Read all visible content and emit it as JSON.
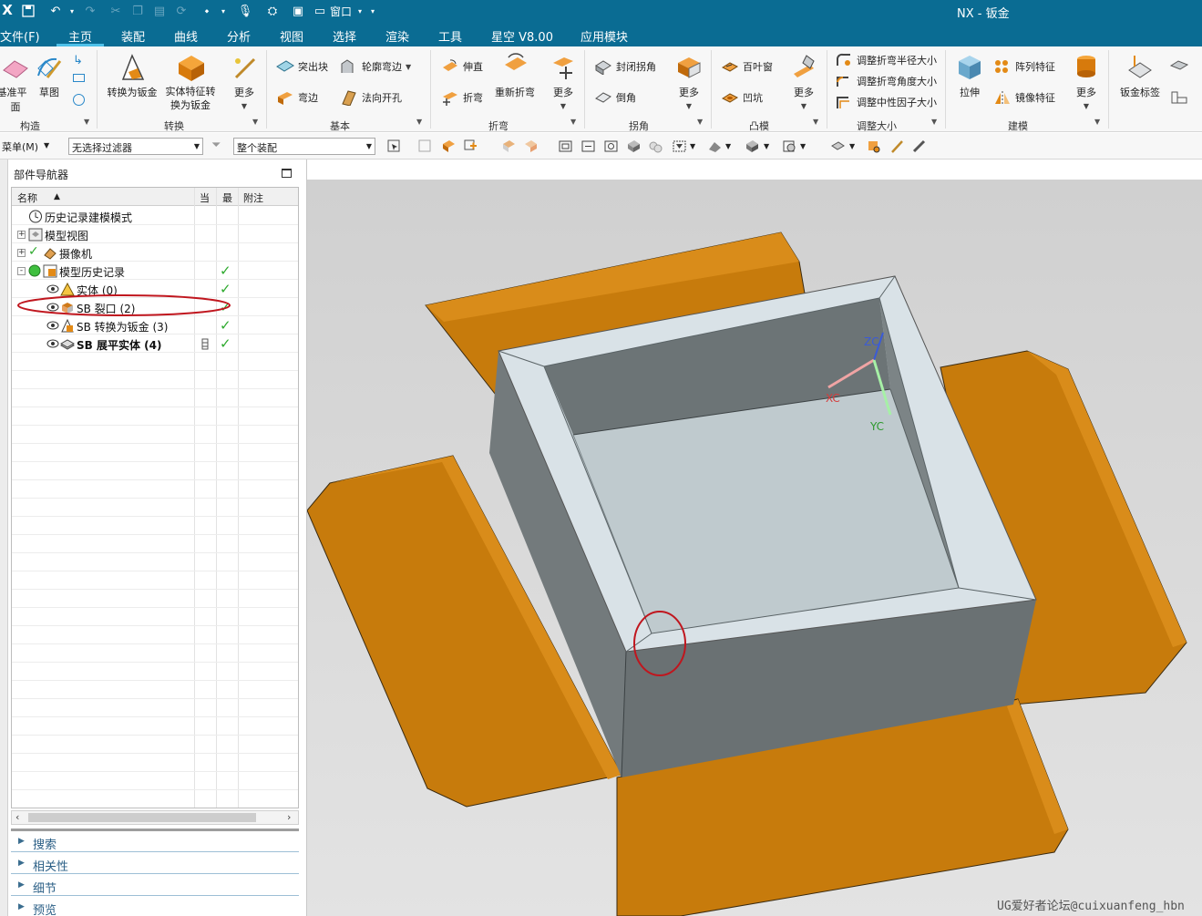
{
  "titlebar": {
    "logo": "X",
    "window_menu": "窗口",
    "app_title": "NX - 钣金"
  },
  "menu": {
    "tabs": [
      "文件(F)",
      "主页",
      "装配",
      "曲线",
      "分析",
      "视图",
      "选择",
      "渲染",
      "工具",
      "星空 V8.00",
      "应用模块"
    ],
    "active": "主页"
  },
  "ribbon": {
    "construct": {
      "label": "构造",
      "items": [
        "基准平面",
        "草图"
      ]
    },
    "convert": {
      "label": "转换",
      "items": [
        "转换为钣金",
        "实体特征转换为钣金",
        "更多"
      ]
    },
    "basic": {
      "label": "基本",
      "items": [
        "突出块",
        "轮廓弯边",
        "弯边",
        "法向开孔"
      ]
    },
    "bend": {
      "label": "折弯",
      "items": [
        "伸直",
        "折弯",
        "重新折弯",
        "更多"
      ]
    },
    "corner": {
      "label": "拐角",
      "items": [
        "封闭拐角",
        "倒角",
        "更多"
      ]
    },
    "punch": {
      "label": "凸模",
      "items": [
        "百叶窗",
        "凹坑",
        "更多"
      ]
    },
    "resize": {
      "label": "调整大小",
      "items": [
        "调整折弯半径大小",
        "调整折弯角度大小",
        "调整中性因子大小"
      ]
    },
    "modeling": {
      "label": "建模",
      "items": [
        "拉伸",
        "阵列特征",
        "镜像特征",
        "更多"
      ]
    },
    "extra": {
      "items": [
        "钣金标签"
      ]
    }
  },
  "toolbar": {
    "menu_label": "菜单(M)",
    "filter_value": "无选择过滤器",
    "scope_value": "整个装配"
  },
  "navigator": {
    "title": "部件导航器",
    "columns": [
      "名称",
      "当",
      "最",
      "附注"
    ],
    "rows": [
      {
        "label": "历史记录建模模式",
        "indent": 1,
        "expander": "",
        "checked": false,
        "bold": false
      },
      {
        "label": "模型视图",
        "indent": 1,
        "expander": "+",
        "checked": false,
        "bold": false
      },
      {
        "label": "摄像机",
        "indent": 1,
        "expander": "+",
        "checked": false,
        "bold": false
      },
      {
        "label": "模型历史记录",
        "indent": 1,
        "expander": "-",
        "checked": true,
        "bold": false
      },
      {
        "label": "实体 (0)",
        "indent": 2,
        "expander": "",
        "checked": true,
        "bold": false
      },
      {
        "label": "SB 裂口 (2)",
        "indent": 2,
        "expander": "",
        "checked": true,
        "bold": false,
        "highlighted": true
      },
      {
        "label": "SB 转换为钣金 (3)",
        "indent": 2,
        "expander": "",
        "checked": true,
        "bold": false
      },
      {
        "label": "SB 展平实体 (4)",
        "indent": 2,
        "expander": "",
        "checked": true,
        "bold": true
      }
    ],
    "panels": [
      "搜索",
      "相关性",
      "细节",
      "预览"
    ]
  },
  "viewport": {
    "axes": {
      "zc": "ZC",
      "xc": "XC",
      "yc": "YC"
    },
    "watermark": "UG爱好者论坛@cuixuanfeng_hbn",
    "colors": {
      "flange": "#c77b0c",
      "box_dark": "#6e7476",
      "box_light": "#c9d3d8",
      "highlight": "#c0161e"
    }
  }
}
